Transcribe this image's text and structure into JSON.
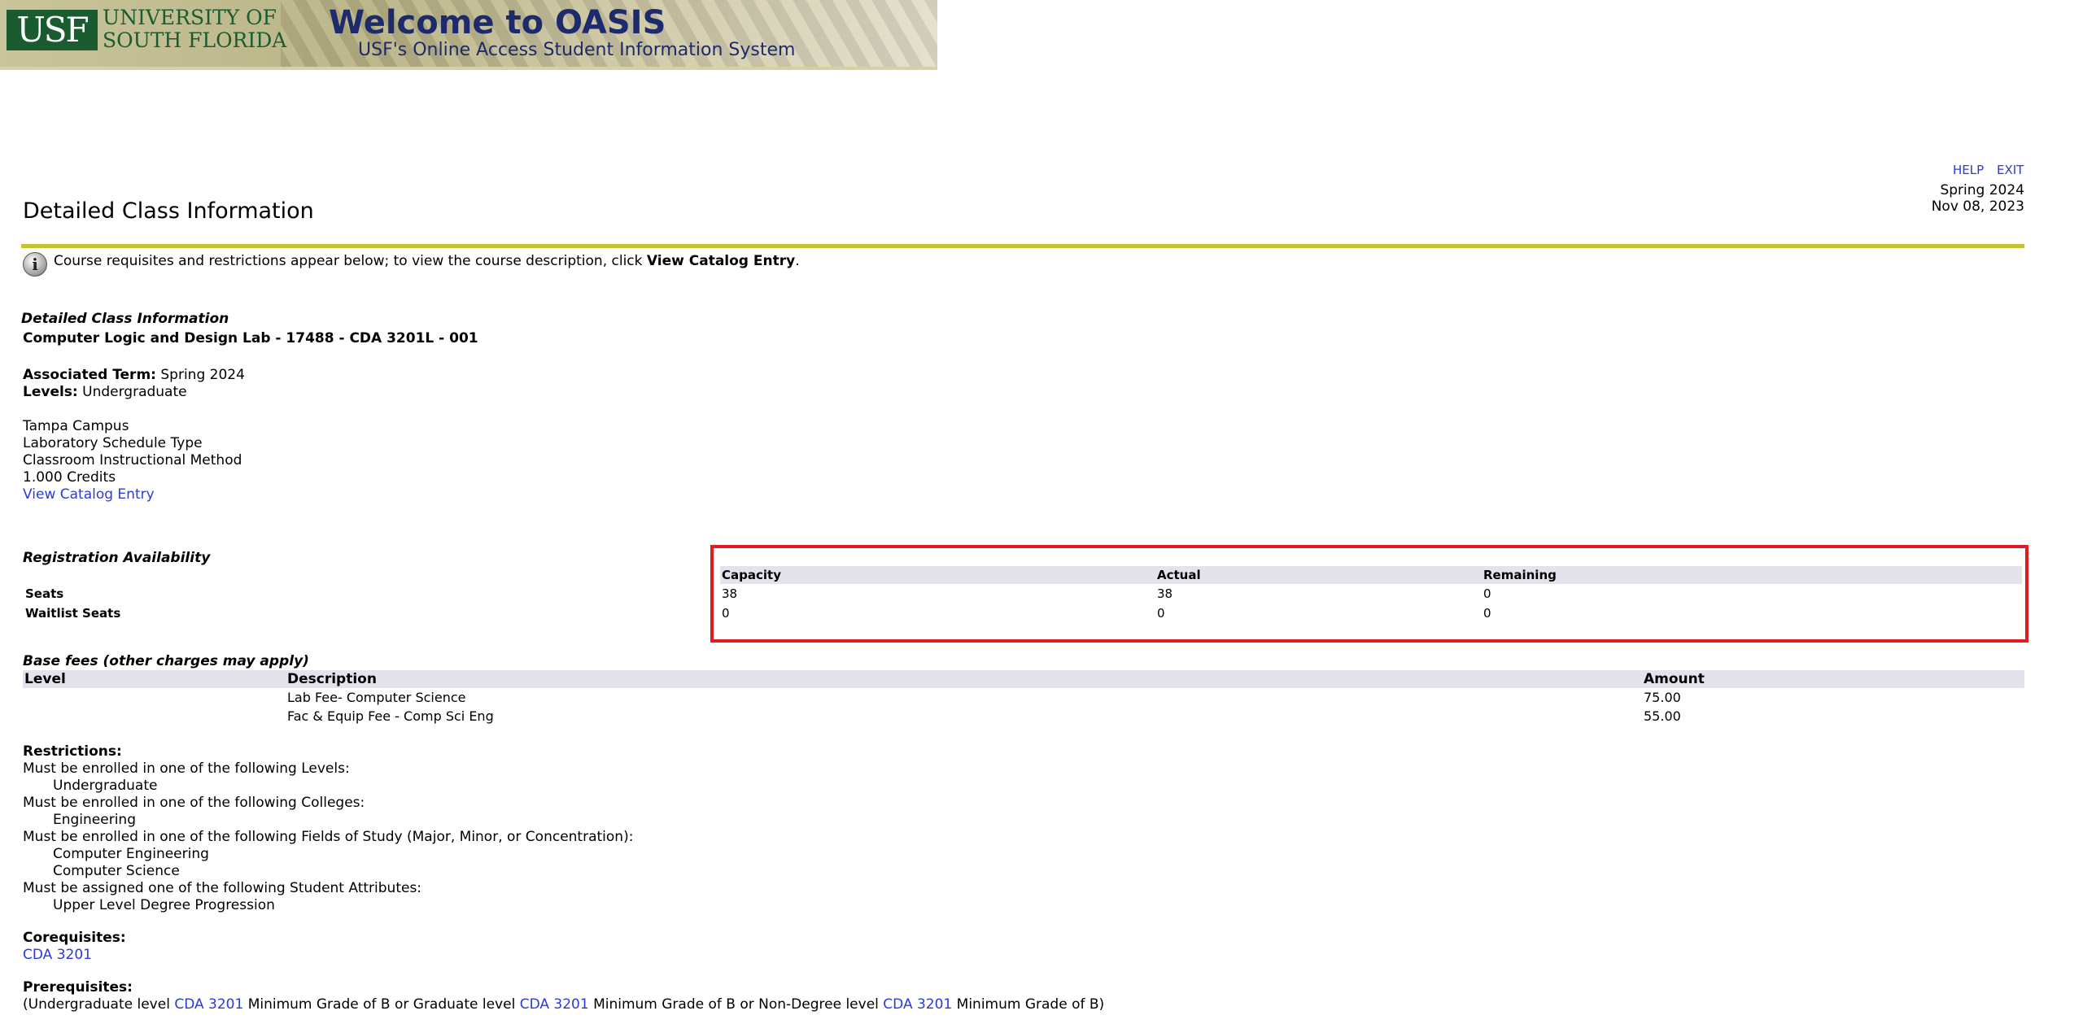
{
  "banner": {
    "logo_text": "USF",
    "university_line1": "UNIVERSITY OF",
    "university_line2": "SOUTH FLORIDA",
    "welcome": "Welcome to OASIS",
    "subtitle": "USF's Online Access Student Information System"
  },
  "header": {
    "help": "HELP",
    "exit": "EXIT",
    "term": "Spring 2024",
    "date": "Nov 08, 2023"
  },
  "page_title": "Detailed Class Information",
  "info": {
    "text_before": "Course requisites and restrictions appear below; to view the course description, click ",
    "bold_link": "View Catalog Entry",
    "text_after": "."
  },
  "section_heading": "Detailed Class Information",
  "class_title": "Computer Logic and Design Lab - 17488 - CDA 3201L - 001",
  "associated_term_label": "Associated Term:",
  "associated_term": "Spring 2024",
  "levels_label": "Levels:",
  "levels": "Undergraduate",
  "campus": "Tampa Campus",
  "schedule_type": "Laboratory Schedule Type",
  "instructional_method": "Classroom Instructional Method",
  "credits": "1.000 Credits",
  "catalog_link": "View Catalog Entry",
  "availability": {
    "heading": "Registration Availability",
    "headers": [
      "Capacity",
      "Actual",
      "Remaining"
    ],
    "seats_label": "Seats",
    "waitlist_label": "Waitlist Seats",
    "seats": [
      "38",
      "38",
      "0"
    ],
    "waitlist": [
      "0",
      "0",
      "0"
    ]
  },
  "fees": {
    "heading": "Base fees (other charges may apply)",
    "headers": [
      "Level",
      "Description",
      "Amount"
    ],
    "rows": [
      {
        "level": "",
        "description": "Lab Fee- Computer Science",
        "amount": "75.00"
      },
      {
        "level": "",
        "description": "Fac & Equip Fee - Comp Sci Eng",
        "amount": "55.00"
      }
    ]
  },
  "restrictions": {
    "heading": "Restrictions:",
    "levels_rule": "Must be enrolled in one of the following Levels:",
    "levels_value": "Undergraduate",
    "colleges_rule": "Must be enrolled in one of the following Colleges:",
    "colleges_value": "Engineering",
    "fields_rule": "Must be enrolled in one of the following Fields of Study (Major, Minor, or Concentration):",
    "fields_value1": "Computer Engineering",
    "fields_value2": "Computer Science",
    "attributes_rule": "Must be assigned one of the following Student Attributes:",
    "attributes_value": "Upper Level Degree Progression"
  },
  "corequisites": {
    "heading": "Corequisites:",
    "course": "CDA 3201"
  },
  "prerequisites": {
    "heading": "Prerequisites:",
    "t1": "(Undergraduate level ",
    "c1": "CDA 3201",
    "t2": " Minimum Grade of B or Graduate level ",
    "c2": "CDA 3201",
    "t3": " Minimum Grade of B or Non-Degree level ",
    "c3": "CDA 3201",
    "t4": " Minimum Grade of B)"
  },
  "colors": {
    "title_rule": "#c4c430",
    "highlight_box": "#e01c24",
    "table_header_bg": "#e3e3ed",
    "link": "#2b3bd8"
  }
}
